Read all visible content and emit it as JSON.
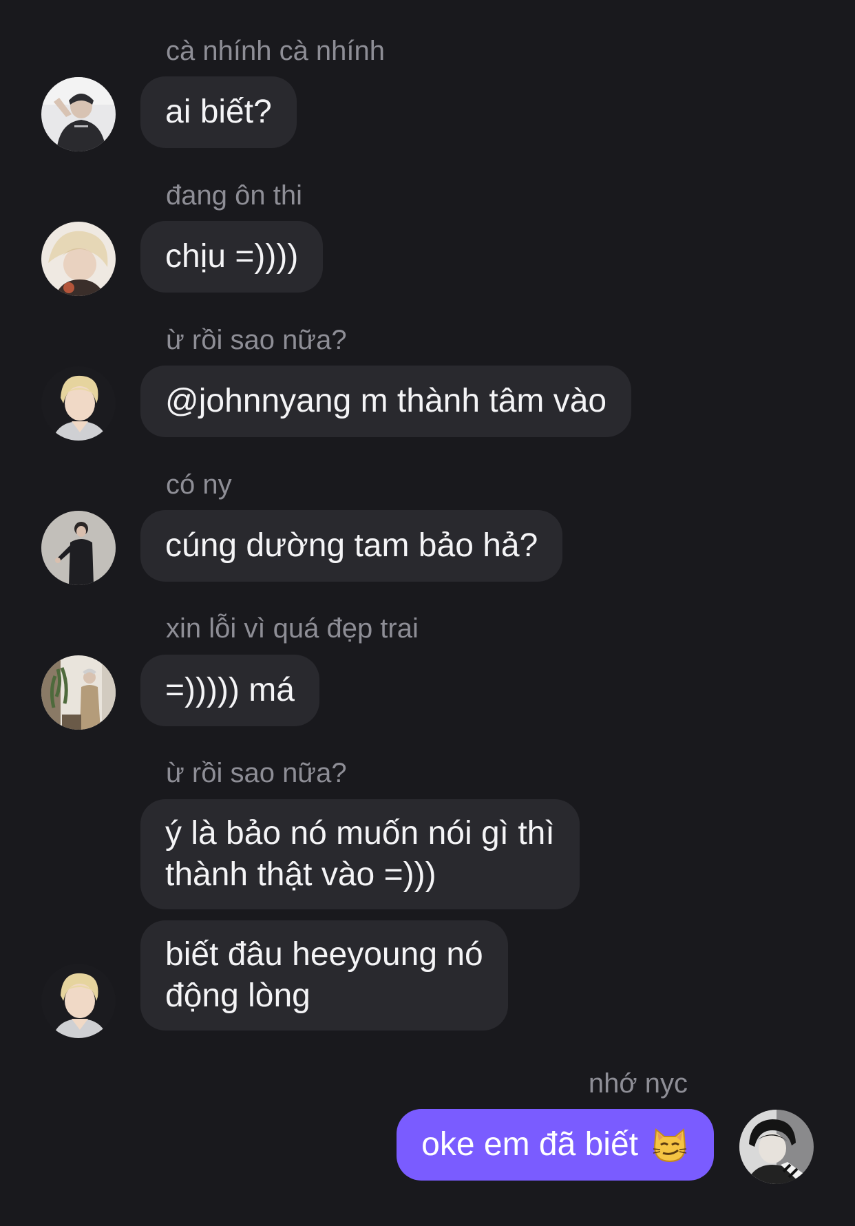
{
  "messages": [
    {
      "sender": "cà nhính cà nhính",
      "text": "ai biết?"
    },
    {
      "sender": "đang ôn thi",
      "text": "chịu =))))"
    },
    {
      "sender": "ừ rồi sao nữa?",
      "text": "@johnnyang m thành tâm vào"
    },
    {
      "sender": "có ny",
      "text": "cúng dường tam bảo hả?"
    },
    {
      "sender": "xin lỗi vì quá đẹp trai",
      "text": "=))))) má"
    },
    {
      "sender": "ừ rồi sao nữa?",
      "lines": [
        "ý là bảo nó muốn nói gì thì",
        "thành thật vào =)))"
      ]
    },
    {
      "lines": [
        "biết đâu heeyoung nó",
        "động lòng"
      ]
    }
  ],
  "own_message": {
    "sender": "nhớ nyc",
    "text": "oke em đã biết",
    "emoji": "smirking-cat-icon"
  },
  "colors": {
    "background": "#19191d",
    "bubble": "#29292e",
    "own_bubble": "#7a5cff",
    "sender_text": "#8e8e96"
  }
}
